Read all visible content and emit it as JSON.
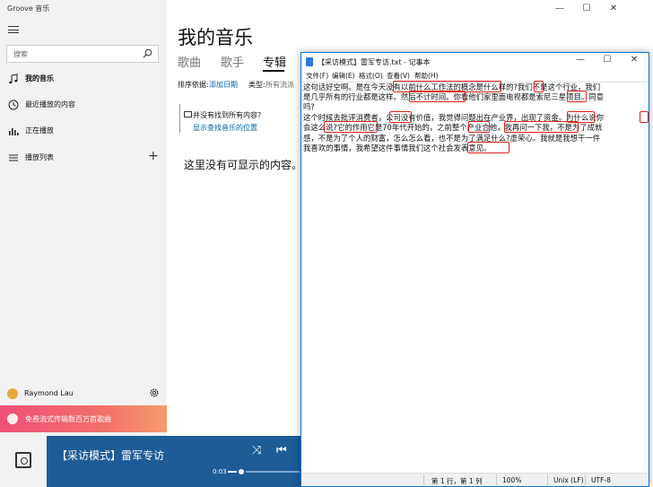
{
  "groove": {
    "app_title": "Groove 音乐",
    "window_controls": [
      "—",
      "☐",
      "✕"
    ],
    "search_placeholder": "搜索",
    "nav": [
      {
        "label": "我的音乐",
        "icon": "music-note-icon"
      },
      {
        "label": "最近播放的内容",
        "icon": "clock-icon"
      },
      {
        "label": "正在播放",
        "icon": "equalizer-icon"
      },
      {
        "label": "播放列表",
        "icon": "playlist-icon"
      }
    ],
    "add_playlist": "+",
    "user_name": "Raymond Lau",
    "promo_text": "免费流式传输数百万首歌曲",
    "page_title": "我的音乐",
    "tabs": [
      "歌曲",
      "歌手",
      "专辑"
    ],
    "active_tab": "专辑",
    "sort_label": "排序依据:",
    "sort_value": "添加日期",
    "filter_label": "类型:",
    "filter_value": "所有流派",
    "notice_question": "并没有找到所有内容?",
    "notice_link": "显示查找音乐的位置",
    "empty_message": "这里没有可显示的内容。",
    "player": {
      "song_title": "【采访模式】雷军专访",
      "time": "0:03",
      "progress": 0.12,
      "shuffle": "⤨",
      "prev": "⏮"
    },
    "accent_color": "#1d5c97"
  },
  "notepad": {
    "title": "【采访模式】雷军专访.txt - 记事本",
    "window_controls": [
      "—",
      "☐",
      "✕"
    ],
    "menu": [
      "文件(F)",
      "编辑(E)",
      "格式(O)",
      "查看(V)",
      "帮助(H)"
    ],
    "lines": [
      "这句话好空啊。是在今天没有以前什么工作法的概念是什么样的?我们不是这个行业，我们",
      "是几乎所有的行业都是这样。然后不计时间。你看他们家里面电视都是索尼三星项目。同意",
      "吗?",
      "这个时候去批评消费者，公司没有价值，我觉得问题出在产业界，出现了资金。为什么说你",
      "会这么说?它的作用它是70年代开始的，之前整个产业合他，我再问一下我，不是为了成就",
      "感，不是为了个人的财富，怎么怎么看，也不是为了满足什么?虚荣心。我就是我想干一件",
      "我喜欢的事情，我希望这件事情我们这个社会发表意见。"
    ],
    "status": {
      "position": "第 1 行，第 1 列",
      "zoom": "100%",
      "eol": "Unix (LF)",
      "encoding": "UTF-8"
    },
    "highlight_color": "#e0201a"
  }
}
